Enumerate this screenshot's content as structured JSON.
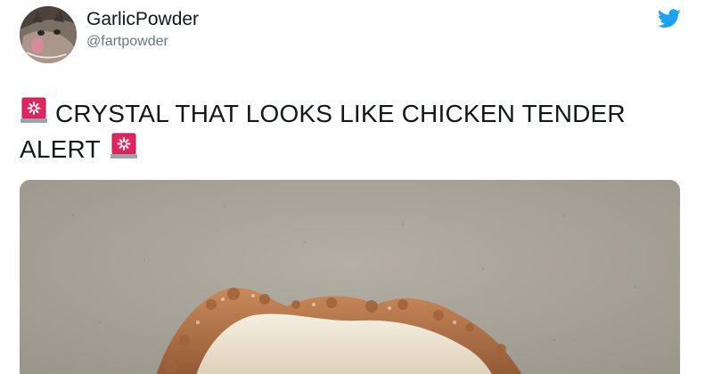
{
  "tweet": {
    "author": {
      "display_name": "GarlicPowder",
      "handle": "@fartpowder",
      "avatar_icon": "cat-avatar"
    },
    "platform_icon": "twitter-bird-icon",
    "text_line_1": "CRYSTAL THAT LOOKS LIKE CHICKEN TENDER",
    "text_line_2": "ALERT",
    "emoji": "rotating-light-icon",
    "media_description_icon": "crystal-photo"
  },
  "colors": {
    "name": "#14171a",
    "handle": "#657786",
    "twitter_blue": "#1da1f2",
    "siren_red": "#e0245e"
  }
}
